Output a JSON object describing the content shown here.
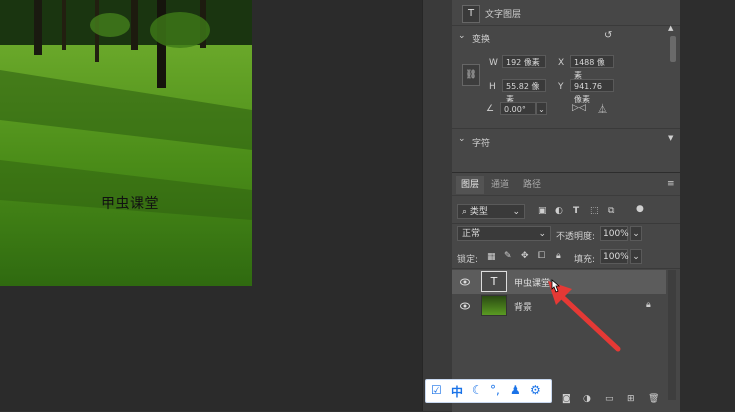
{
  "canvas": {
    "text_layer_content": "甲虫课堂"
  },
  "properties": {
    "header_label": "文字图层",
    "transform_title": "变换",
    "w_label": "W",
    "w_value": "192 像素",
    "x_label": "X",
    "x_value": "1488 像素",
    "h_label": "H",
    "h_value": "55.82 像素",
    "y_label": "Y",
    "y_value": "941.76 像素",
    "angle_value": "0.00°",
    "char_title": "字符"
  },
  "layers_panel": {
    "tabs": [
      "图层",
      "通道",
      "路径"
    ],
    "filter_label": "类型",
    "blend_mode": "正常",
    "opacity_label": "不透明度:",
    "opacity_value": "100%",
    "lock_label": "锁定:",
    "fill_label": "填充:",
    "fill_value": "100%",
    "layers": [
      {
        "name": "甲虫课堂",
        "type": "text",
        "selected": true
      },
      {
        "name": "背景",
        "type": "image",
        "selected": false,
        "locked": true
      }
    ],
    "bottom_icons": [
      "link-icon",
      "fx-icon",
      "mask-icon",
      "adjustment-icon",
      "group-icon",
      "new-layer-icon",
      "trash-icon"
    ]
  },
  "ime_toolbar": {
    "mode_label": "中",
    "icons": [
      "check-icon",
      "moon-icon",
      "punct-icon",
      "user-icon",
      "gear-icon"
    ]
  },
  "colors": {
    "panel_bg": "#474747",
    "annotation_arrow": "#e53935",
    "ime_blue": "#1a73e8"
  }
}
